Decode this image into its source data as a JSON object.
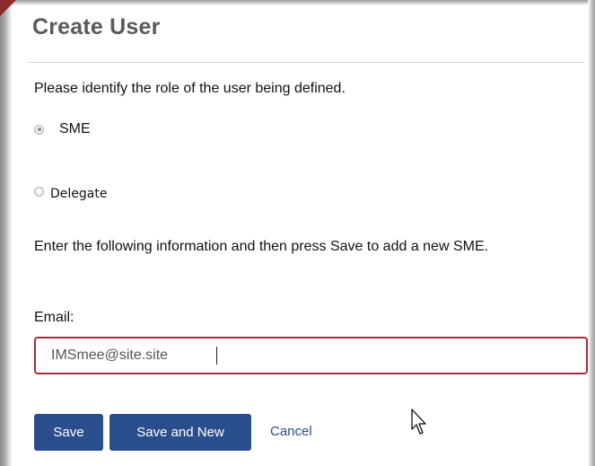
{
  "dialog": {
    "title": "Create User",
    "intro": "Please identify the role of the user being defined.",
    "roles": [
      {
        "label": "SME",
        "selected": true
      },
      {
        "label": "Delegate",
        "selected": false
      }
    ],
    "instructions": "Enter the following information and then press Save to add a new SME.",
    "email": {
      "label": "Email:",
      "value": "IMSmee@site.site"
    },
    "buttons": {
      "save": "Save",
      "save_and_new": "Save and New",
      "cancel": "Cancel"
    }
  },
  "colors": {
    "title": "#5a5a5a",
    "button": "#2a4e8c",
    "input_border": "#a0303c",
    "link": "#2a4e8c",
    "corner_accent": "#8b2b2b"
  },
  "icons": {
    "mouse_cursor": "mouse-pointer-icon"
  }
}
